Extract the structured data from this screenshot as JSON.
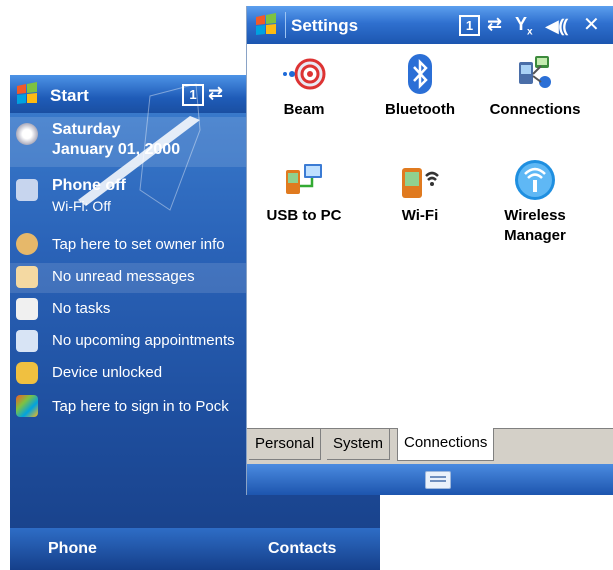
{
  "today": {
    "title": "Start",
    "date_line1": "Saturday",
    "date_line2": "January 01, 2000",
    "phone_line1": "Phone off",
    "phone_line2": "Wi-Fi: Off",
    "owner": "Tap here to set owner info",
    "messages": "No unread messages",
    "tasks": "No tasks",
    "appointments": "No upcoming appointments",
    "device": "Device unlocked",
    "signin": "Tap here to sign in to Pock",
    "softkey_left": "Phone",
    "softkey_right": "Contacts"
  },
  "settings": {
    "title": "Settings",
    "apps": [
      {
        "label": "Beam",
        "icon": "beam-icon"
      },
      {
        "label": "Bluetooth",
        "icon": "bluetooth-icon"
      },
      {
        "label": "Connections",
        "icon": "connections-icon"
      },
      {
        "label": "USB to PC",
        "icon": "usb-to-pc-icon"
      },
      {
        "label": "Wi-Fi",
        "icon": "wifi-icon"
      },
      {
        "label": "Wireless Manager",
        "icon": "wireless-manager-icon"
      }
    ],
    "tabs": [
      "Personal",
      "System",
      "Connections"
    ],
    "active_tab": "Connections"
  },
  "colors": {
    "titlebar_blue": "#2f70cf",
    "today_background": "#2a63b8",
    "tab_gray": "#d4d0c8"
  }
}
